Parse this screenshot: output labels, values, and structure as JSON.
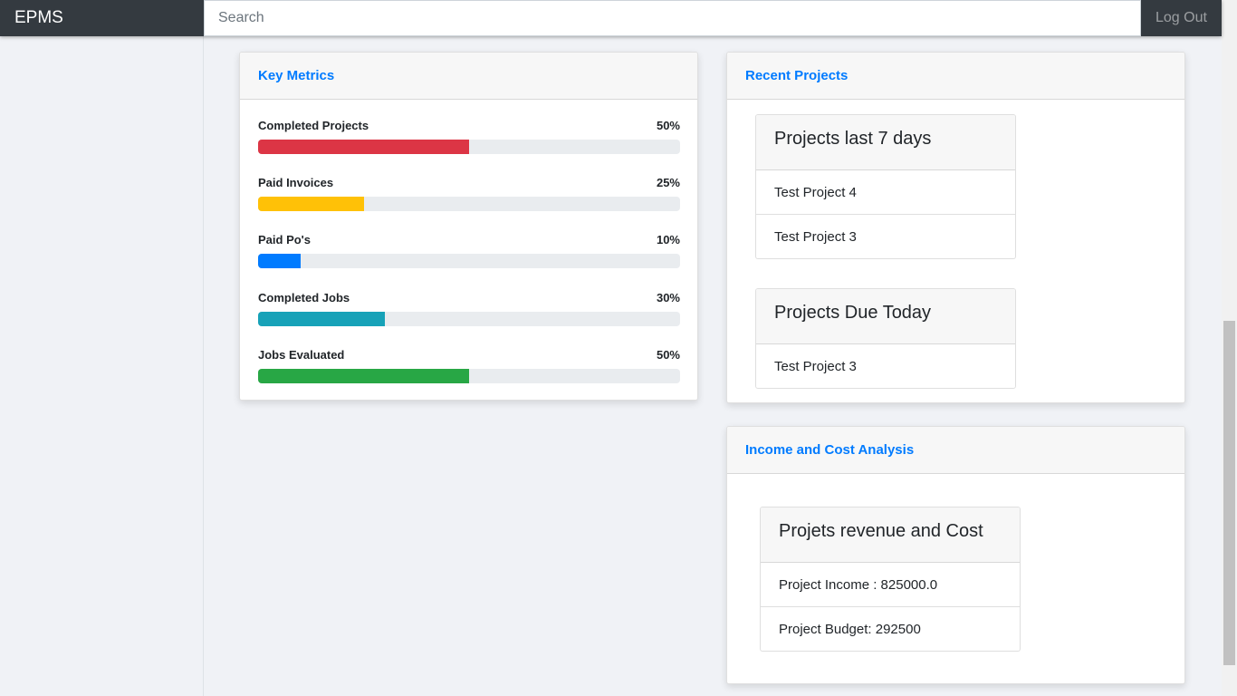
{
  "navbar": {
    "brand": "EPMS",
    "search_placeholder": "Search",
    "logout_label": "Log Out"
  },
  "key_metrics": {
    "title": "Key Metrics",
    "items": [
      {
        "label": "Completed Projects",
        "percent_label": "50%",
        "value": 50,
        "color": "#dc3545"
      },
      {
        "label": "Paid Invoices",
        "percent_label": "25%",
        "value": 25,
        "color": "#ffc107"
      },
      {
        "label": "Paid Po's",
        "percent_label": "10%",
        "value": 10,
        "color": "#007bff"
      },
      {
        "label": "Completed Jobs",
        "percent_label": "30%",
        "value": 30,
        "color": "#17a2b8"
      },
      {
        "label": "Jobs Evaluated",
        "percent_label": "50%",
        "value": 50,
        "color": "#28a745"
      }
    ]
  },
  "recent_projects": {
    "title": "Recent Projects",
    "last7": {
      "title": "Projects last 7 days",
      "items": [
        "Test Project 4",
        "Test Project 3"
      ]
    },
    "due_today": {
      "title": "Projects Due Today",
      "items": [
        "Test Project 3"
      ]
    }
  },
  "income_cost": {
    "title": "Income and Cost Analysis",
    "box_title": "Projets revenue and Cost",
    "items": [
      "Project Income : 825000.0",
      "Project Budget: 292500"
    ]
  },
  "colors": {
    "accent": "#007bff",
    "navbar": "#343a40"
  }
}
